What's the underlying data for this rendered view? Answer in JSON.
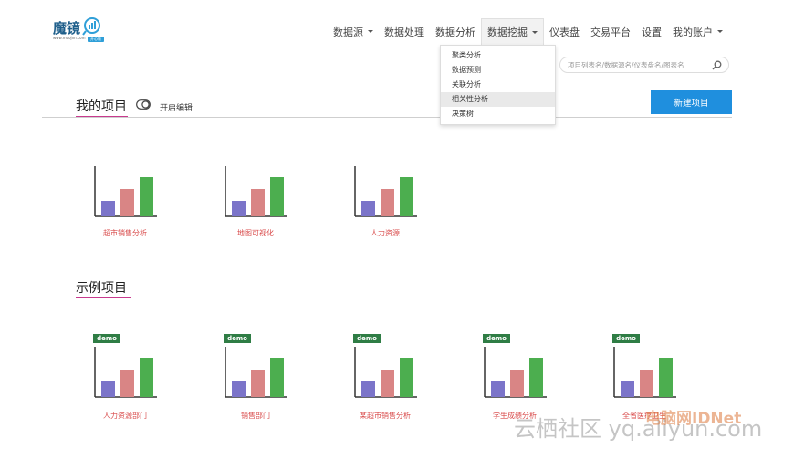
{
  "logo": {
    "name": "魔镜",
    "tagline": "www.moojnn.com",
    "tag": "开心版"
  },
  "nav": [
    {
      "label": "数据源",
      "has_caret": true
    },
    {
      "label": "数据处理",
      "has_caret": false
    },
    {
      "label": "数据分析",
      "has_caret": false
    },
    {
      "label": "数据挖掘",
      "has_caret": true,
      "active": true
    },
    {
      "label": "仪表盘",
      "has_caret": false
    },
    {
      "label": "交易平台",
      "has_caret": false
    },
    {
      "label": "设置",
      "has_caret": false
    },
    {
      "label": "我的账户",
      "has_caret": true
    }
  ],
  "dropdown": {
    "items": [
      "聚类分析",
      "数据预测",
      "关联分析",
      "相关性分析",
      "决策树"
    ],
    "highlighted": "相关性分析"
  },
  "search": {
    "placeholder": "项目列表名/数据源名/仪表盘名/图表名"
  },
  "my_projects": {
    "title": "我的项目",
    "edit_label": "开启编辑",
    "new_button": "新建项目",
    "items": [
      "超市销售分析",
      "地图可视化",
      "人力资源"
    ]
  },
  "examples": {
    "title": "示例项目",
    "badge": "demo",
    "items": [
      "人力资源部门",
      "销售部门",
      "某超市销售分析",
      "学生成绩分析",
      "全省医疗卫生"
    ]
  },
  "colors": {
    "bar1": "#7b74c9",
    "bar2": "#d98585",
    "bar3": "#4cae4f",
    "accent": "#1f8fde",
    "label": "#d94c4c",
    "underline": "#c83a8e"
  },
  "watermark": {
    "text": "云栖社区 yq.aliyun.com",
    "site": "电脑网IDNet"
  }
}
